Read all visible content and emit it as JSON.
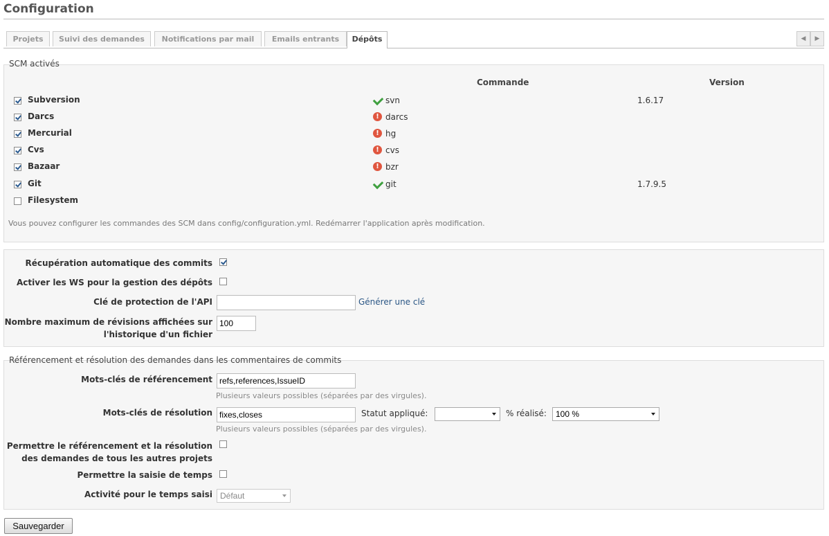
{
  "page": {
    "title": "Configuration"
  },
  "tabs": [
    {
      "label": "Projets"
    },
    {
      "label": "Suivi des demandes"
    },
    {
      "label": "Notifications par mail"
    },
    {
      "label": "Emails entrants"
    },
    {
      "label": "Dépôts",
      "selected": true
    }
  ],
  "scm": {
    "legend": "SCM activés",
    "col_command": "Commande",
    "col_version": "Version",
    "rows": [
      {
        "name": "Subversion",
        "checked": true,
        "status": "ok",
        "command": "svn",
        "version": "1.6.17"
      },
      {
        "name": "Darcs",
        "checked": true,
        "status": "error",
        "command": "darcs",
        "version": ""
      },
      {
        "name": "Mercurial",
        "checked": true,
        "status": "error",
        "command": "hg",
        "version": ""
      },
      {
        "name": "Cvs",
        "checked": true,
        "status": "error",
        "command": "cvs",
        "version": ""
      },
      {
        "name": "Bazaar",
        "checked": true,
        "status": "error",
        "command": "bzr",
        "version": ""
      },
      {
        "name": "Git",
        "checked": true,
        "status": "ok",
        "command": "git",
        "version": "1.7.9.5"
      },
      {
        "name": "Filesystem",
        "checked": false,
        "status": "",
        "command": "",
        "version": ""
      }
    ],
    "note": "Vous pouvez configurer les commandes des SCM dans config/configuration.yml. Redémarrer l'application après modification."
  },
  "settings": {
    "autofetch_label": "Récupération automatique des commits",
    "autofetch_checked": true,
    "ws_label": "Activer les WS pour la gestion des dépôts",
    "ws_checked": false,
    "api_key_label": "Clé de protection de l'API",
    "api_key_value": "",
    "generate_key_link": "Générer une clé",
    "max_revisions_label_1": "Nombre maximum de révisions affichées sur",
    "max_revisions_label_2": "l'historique d'un fichier",
    "max_revisions_value": "100"
  },
  "referencing": {
    "legend": "Référencement et résolution des demandes dans les commentaires de commits",
    "ref_keywords_label": "Mots-clés de référencement",
    "ref_keywords_value": "refs,references,IssueID",
    "ref_hint": "Plusieurs valeurs possibles (séparées par des virgules).",
    "fix_keywords_label": "Mots-clés de résolution",
    "fix_keywords_value": "fixes,closes",
    "status_label": "Statut appliqué:",
    "status_value": "",
    "done_ratio_label": "% réalisé:",
    "done_ratio_value": "100 %",
    "fix_hint": "Plusieurs valeurs possibles (séparées par des virgules).",
    "cross_project_label_1": "Permettre le référencement et la résolution",
    "cross_project_label_2": "des demandes de tous les autres projets",
    "cross_project_checked": false,
    "time_logging_label": "Permettre la saisie de temps",
    "time_logging_checked": false,
    "activity_label": "Activité pour le temps saisi",
    "activity_value": "Défaut"
  },
  "save_button": "Sauvegarder"
}
